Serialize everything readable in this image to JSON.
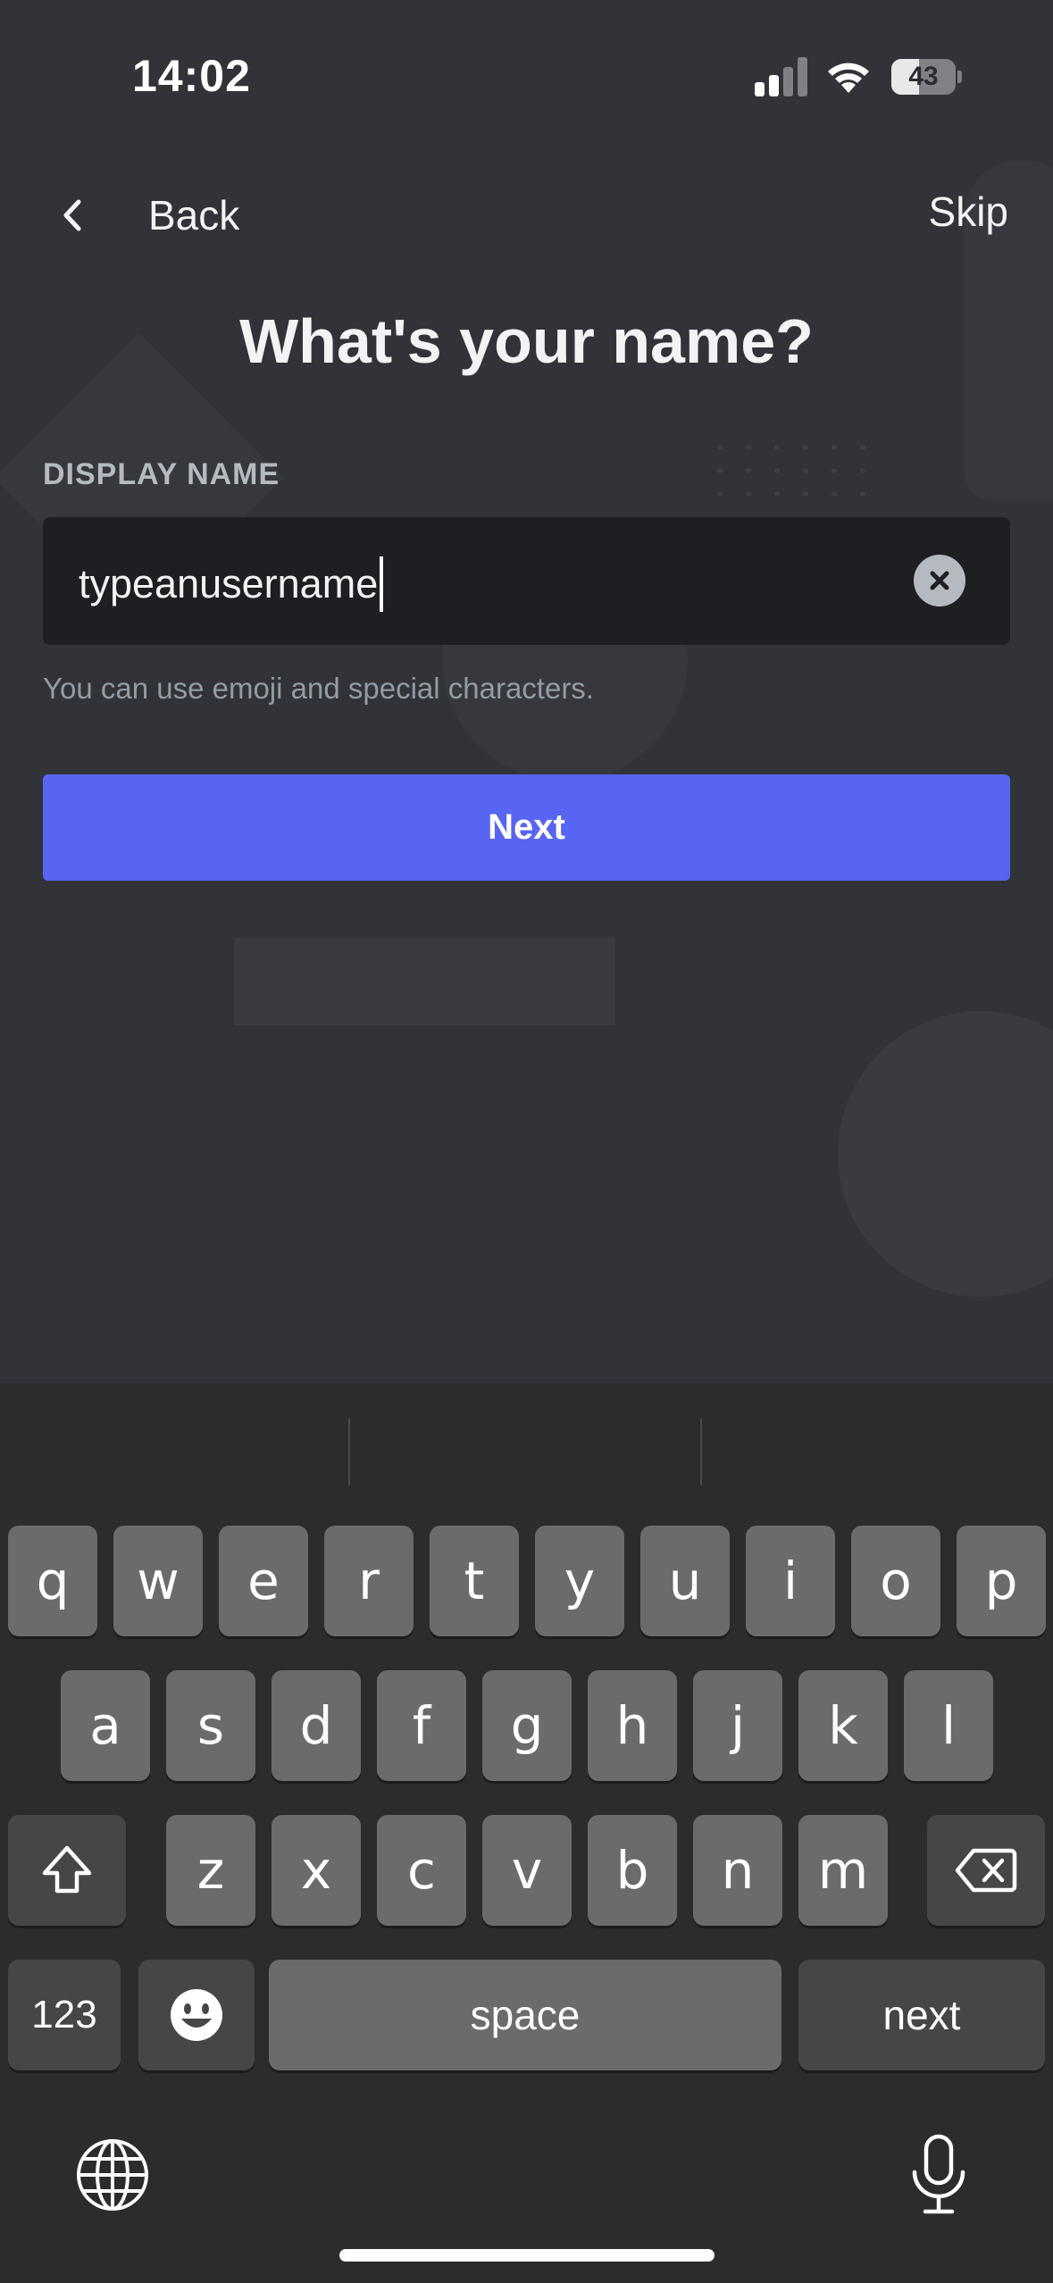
{
  "status_bar": {
    "time": "14:02",
    "battery_percent": 43,
    "battery_text": "43"
  },
  "nav": {
    "back_label": "Back",
    "skip_label": "Skip"
  },
  "page": {
    "title": "What's your name?",
    "field_label": "DISPLAY NAME",
    "input_value": "typeanusername",
    "hint": "You can use emoji and special characters.",
    "next_button": "Next"
  },
  "keyboard": {
    "row1": [
      "q",
      "w",
      "e",
      "r",
      "t",
      "y",
      "u",
      "i",
      "o",
      "p"
    ],
    "row2": [
      "a",
      "s",
      "d",
      "f",
      "g",
      "h",
      "j",
      "k",
      "l"
    ],
    "row3": [
      "z",
      "x",
      "c",
      "v",
      "b",
      "n",
      "m"
    ],
    "numbers_key": "123",
    "space_key": "space",
    "return_key": "next"
  },
  "colors": {
    "background": "#313338",
    "accent": "#5865f2",
    "input_background": "#1e1f22",
    "keyboard_background": "#2c2c2e"
  },
  "icons": [
    "back-chevron-icon",
    "signal-icon",
    "wifi-icon",
    "battery-icon",
    "clear-icon",
    "shift-icon",
    "delete-icon",
    "emoji-icon",
    "globe-icon",
    "microphone-icon"
  ]
}
